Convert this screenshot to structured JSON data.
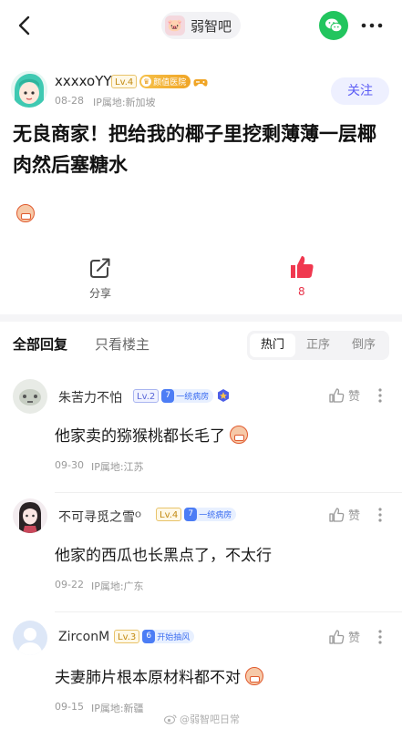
{
  "forum": {
    "name": "弱智吧"
  },
  "author": {
    "name": "xxxxoYY",
    "level": "Lv.4",
    "badge": "颜值医院",
    "date": "08-28",
    "ip": "IP属地:新加坡",
    "follow_label": "关注"
  },
  "post": {
    "title": "无良商家！把给我的椰子里挖剩薄薄一层椰肉然后塞糖水"
  },
  "actions": {
    "share_label": "分享",
    "like_count": "8"
  },
  "replies": {
    "tab_all": "全部回复",
    "tab_author": "只看楼主",
    "sort": [
      "热门",
      "正序",
      "倒序"
    ],
    "active_sort": "热门"
  },
  "comments": [
    {
      "name": "朱苦力不怕",
      "level": "Lv.2",
      "tag_num": "7",
      "tag": "一统病房",
      "like_label": "赞",
      "text": "他家卖的猕猴桃都长毛了",
      "date": "09-30",
      "ip": "IP属地:江苏"
    },
    {
      "name": "不可寻觅之雪ᴼ",
      "level": "Lv.4",
      "tag_num": "7",
      "tag": "一统病房",
      "like_label": "赞",
      "text": "他家的西瓜也长黑点了，不太行",
      "date": "09-22",
      "ip": "IP属地:广东"
    },
    {
      "name": "ZirconM",
      "level": "Lv.3",
      "tag_num": "6",
      "tag": "开始抽风",
      "like_label": "赞",
      "text": "夫妻肺片根本原材料都不对",
      "date": "09-15",
      "ip": "IP属地:新疆"
    }
  ],
  "watermark": "@弱智吧日常",
  "colors": {
    "accent": "#5b5cf5",
    "like": "#e8344a",
    "wechat": "#22c55e"
  }
}
